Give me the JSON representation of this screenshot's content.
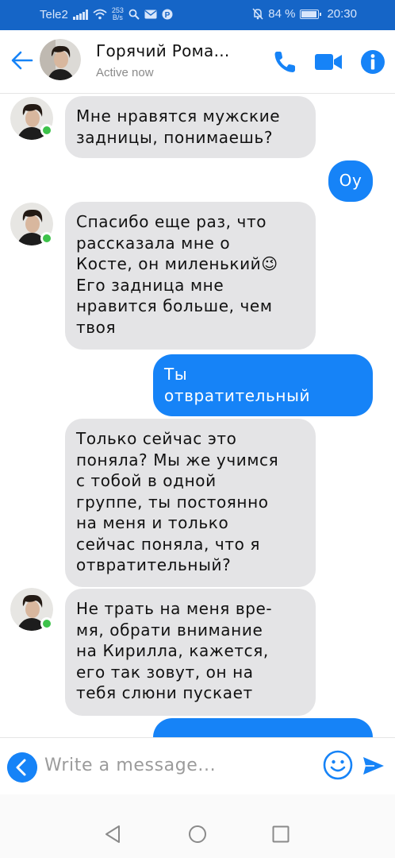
{
  "status_bar": {
    "carrier": "Tele2",
    "net_speed_value": "253",
    "net_speed_unit": "B/s",
    "battery_percent_label": "84 %",
    "battery_level": 0.84,
    "time": "20:30"
  },
  "header": {
    "contact_name": "Горячий Рома...",
    "presence": "Active now",
    "icons": [
      "back-arrow-icon",
      "phone-icon",
      "video-camera-icon",
      "info-icon"
    ],
    "accent_color": "#1683f7"
  },
  "messages": [
    {
      "direction": "incoming",
      "text": "Мне нравятся мужские\nзадницы, понимаешь?"
    },
    {
      "direction": "outgoing",
      "text": "Оу"
    },
    {
      "direction": "incoming",
      "text": "Спасибо еще раз, что\nрассказала мне о\nКосте, он миленький😉\nЕго задница мне\nнравится больше, чем\nтвоя"
    },
    {
      "direction": "outgoing",
      "text": "Ты\nотвратительный"
    },
    {
      "direction": "incoming",
      "text": "Только сейчас это\nпоняла? Мы же учимся\nс тобой в одной\nгруппе, ты постоянно\nна меня и только\nсейчас поняла, что я\nотвратительный?"
    },
    {
      "direction": "incoming",
      "text": "Не трать на меня вре-\nмя, обрати внимание\nна Кирилла, кажется,\nего так зовут, он на\nтебя слюни пускает"
    },
    {
      "direction": "outgoing",
      "text": ""
    }
  ],
  "composer": {
    "placeholder": "Write a message...",
    "icons": [
      "chevron-left-icon",
      "smiley-icon",
      "send-icon"
    ]
  },
  "colors": {
    "status_bar": "#1565c7",
    "incoming_bubble": "#e4e4e6",
    "outgoing_bubble": "#1683f7",
    "online_dot": "#3dc24a"
  }
}
